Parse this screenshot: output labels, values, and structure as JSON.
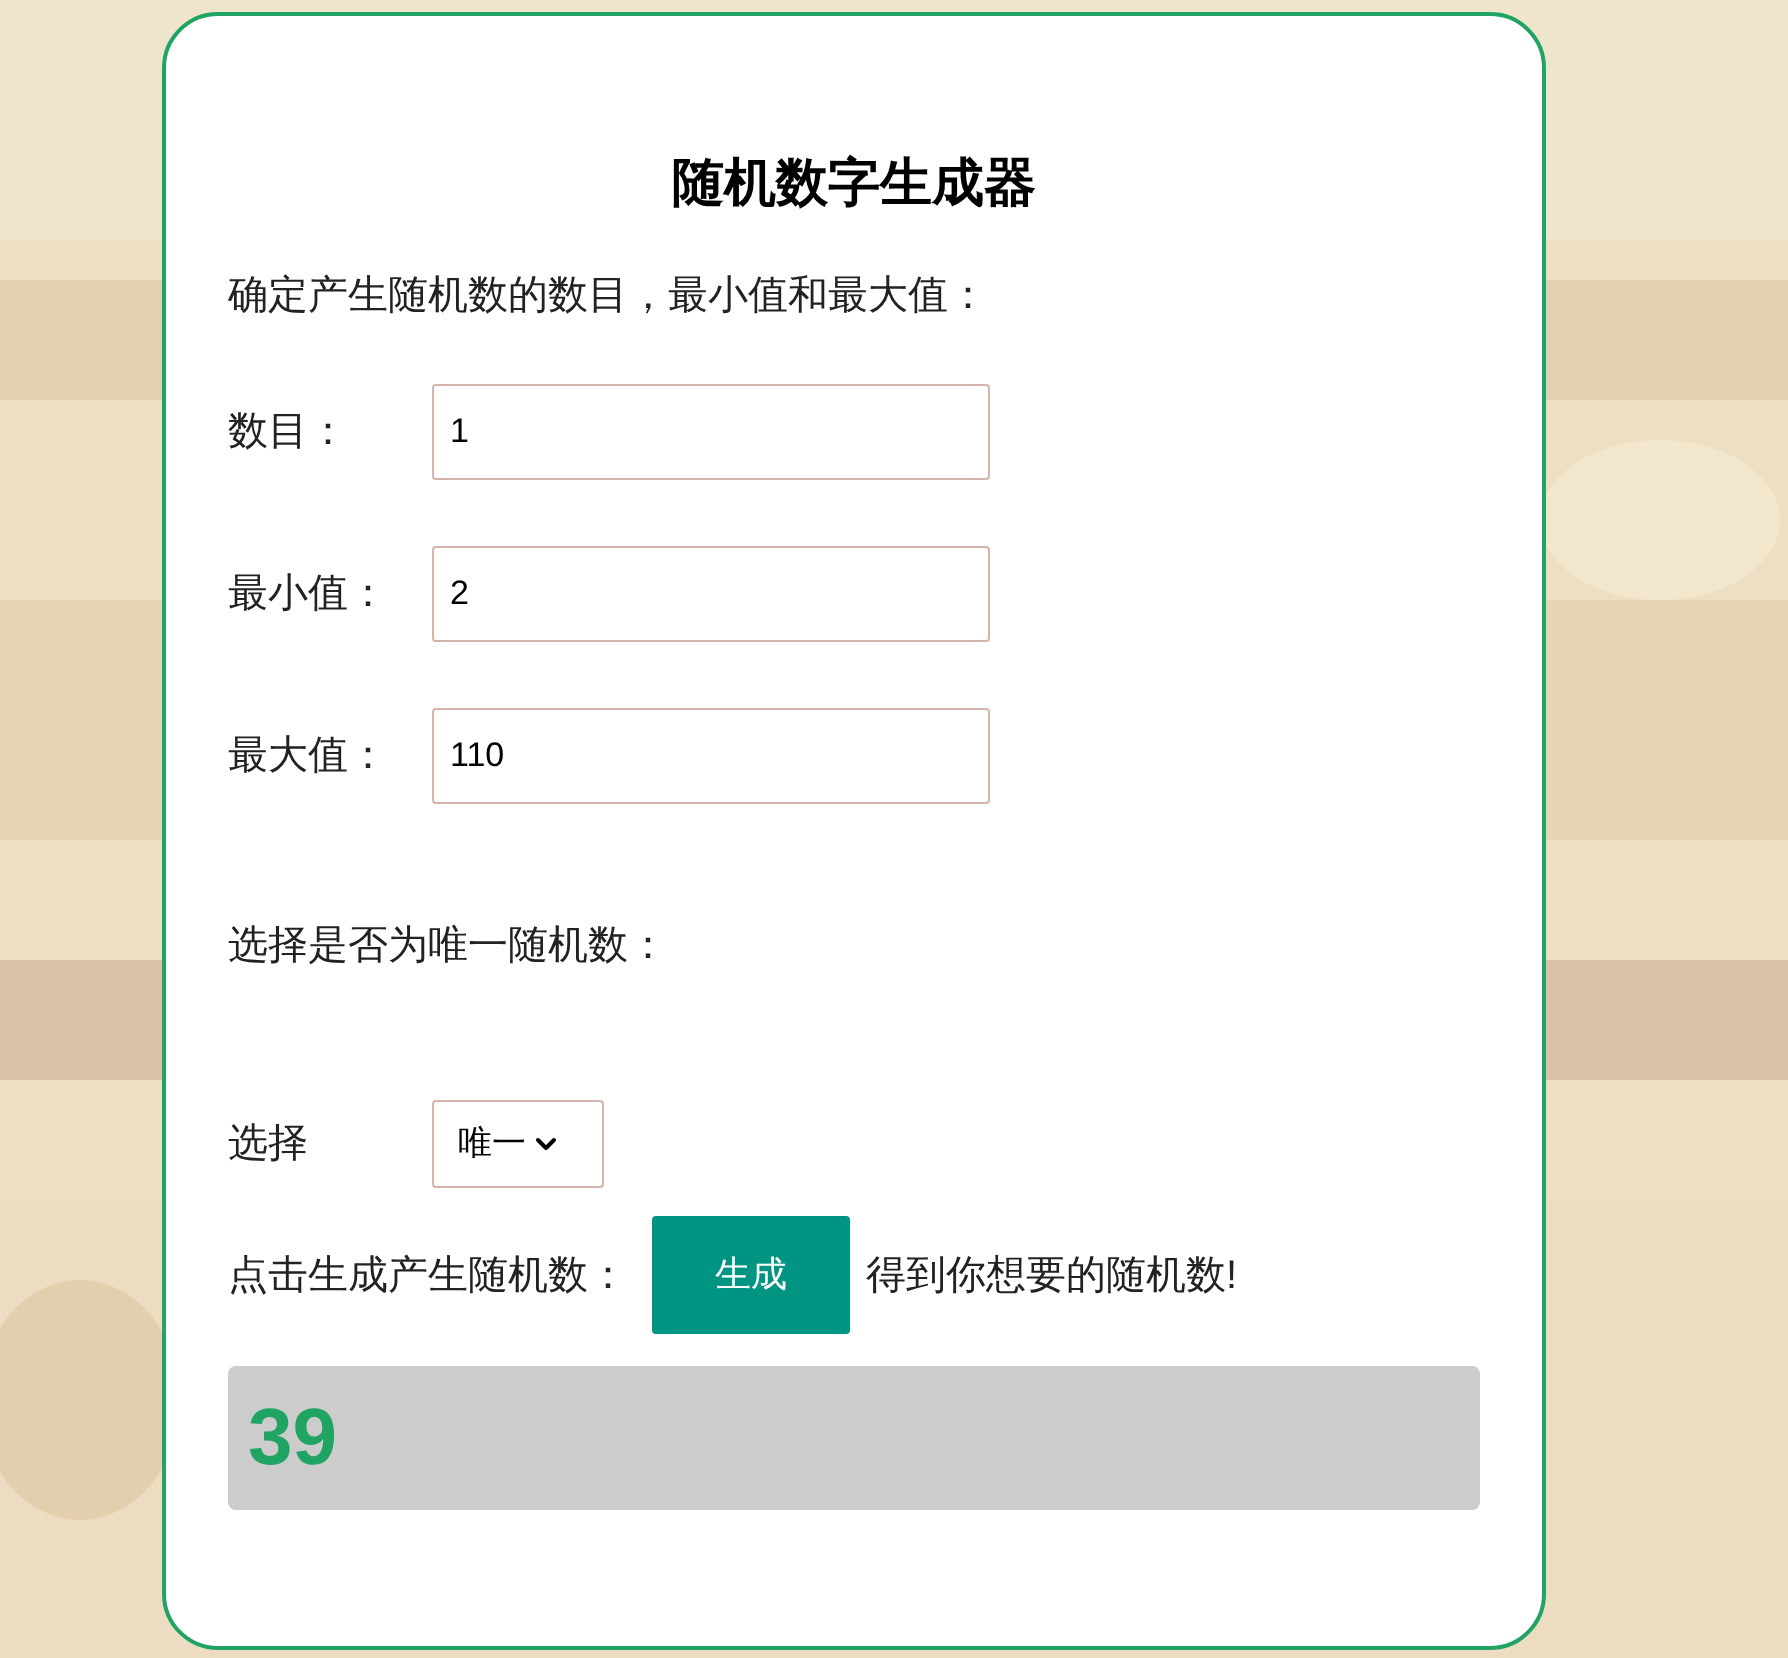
{
  "title": "随机数字生成器",
  "intro": "确定产生随机数的数目，最小值和最大值：",
  "fields": [
    {
      "label": "数目：",
      "value": "1"
    },
    {
      "label": "最小值：",
      "value": "2"
    },
    {
      "label": "最大值：",
      "value": "110"
    }
  ],
  "unique_prompt": "选择是否为唯一随机数：",
  "select": {
    "label": "选择",
    "value": "唯一"
  },
  "generate": {
    "prompt": "点击生成产生随机数：",
    "button": "生成",
    "suffix": "得到你想要的随机数!"
  },
  "result": "39"
}
